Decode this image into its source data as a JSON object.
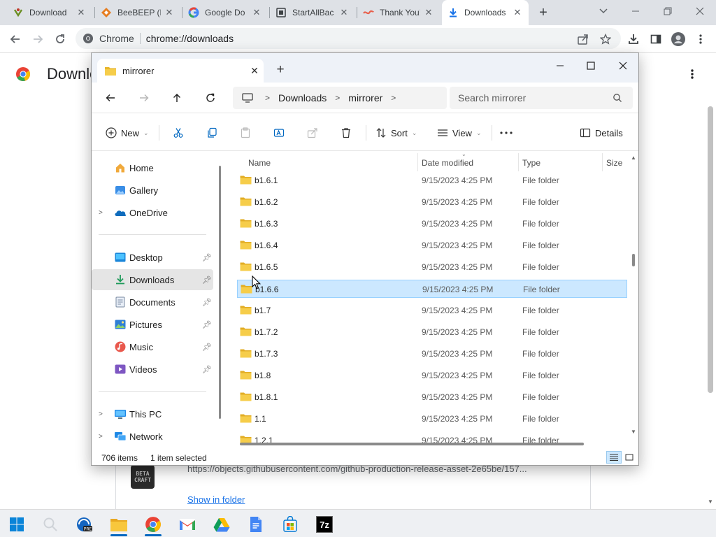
{
  "browser": {
    "tabs": [
      {
        "title": "Download",
        "icon": "download-page-favicon"
      },
      {
        "title": "BeeBEEP (F",
        "icon": "beebeep-favicon"
      },
      {
        "title": "Google Do",
        "icon": "google-favicon"
      },
      {
        "title": "StartAllBac",
        "icon": "startallback-favicon"
      },
      {
        "title": "Thank You!",
        "icon": "thankyou-favicon"
      },
      {
        "title": "Downloads",
        "icon": "download-icon",
        "active": true
      }
    ],
    "omnibox": {
      "site_label": "Chrome",
      "url": "chrome://downloads"
    },
    "page": {
      "title": "Downlo",
      "item": {
        "logo_text": "BETA CRAFT",
        "url": "https://objects.githubusercontent.com/github-production-release-asset-2e65be/157...",
        "show_in_folder": "Show in folder"
      }
    }
  },
  "explorer": {
    "tab_title": "mirrorer",
    "breadcrumb": [
      "Downloads",
      "mirrorer"
    ],
    "search_placeholder": "Search mirrorer",
    "commands": {
      "new": "New",
      "sort": "Sort",
      "view": "View",
      "details": "Details"
    },
    "nav": {
      "home": "Home",
      "gallery": "Gallery",
      "onedrive": "OneDrive",
      "desktop": "Desktop",
      "downloads": "Downloads",
      "documents": "Documents",
      "pictures": "Pictures",
      "music": "Music",
      "videos": "Videos",
      "thispc": "This PC",
      "network": "Network"
    },
    "columns": {
      "name": "Name",
      "date": "Date modified",
      "type": "Type",
      "size": "Size"
    },
    "rows": [
      {
        "name": "b1.6.1",
        "date": "9/15/2023 4:25 PM",
        "type": "File folder"
      },
      {
        "name": "b1.6.2",
        "date": "9/15/2023 4:25 PM",
        "type": "File folder"
      },
      {
        "name": "b1.6.3",
        "date": "9/15/2023 4:25 PM",
        "type": "File folder"
      },
      {
        "name": "b1.6.4",
        "date": "9/15/2023 4:25 PM",
        "type": "File folder"
      },
      {
        "name": "b1.6.5",
        "date": "9/15/2023 4:25 PM",
        "type": "File folder"
      },
      {
        "name": "b1.6.6",
        "date": "9/15/2023 4:25 PM",
        "type": "File folder",
        "selected": true
      },
      {
        "name": "b1.7",
        "date": "9/15/2023 4:25 PM",
        "type": "File folder"
      },
      {
        "name": "b1.7.2",
        "date": "9/15/2023 4:25 PM",
        "type": "File folder"
      },
      {
        "name": "b1.7.3",
        "date": "9/15/2023 4:25 PM",
        "type": "File folder"
      },
      {
        "name": "b1.8",
        "date": "9/15/2023 4:25 PM",
        "type": "File folder"
      },
      {
        "name": "b1.8.1",
        "date": "9/15/2023 4:25 PM",
        "type": "File folder"
      },
      {
        "name": "1.1",
        "date": "9/15/2023 4:25 PM",
        "type": "File folder"
      },
      {
        "name": "1.2.1",
        "date": "9/15/2023 4:25 PM",
        "type": "File folder"
      }
    ],
    "status": {
      "count": "706 items",
      "selection": "1 item selected"
    }
  },
  "taskbar": {
    "items": [
      "windows-start-icon",
      "search-icon",
      "app-icon",
      "file-explorer-icon",
      "chrome-icon",
      "gmail-icon",
      "google-drive-icon",
      "google-docs-icon",
      "store-icon",
      "7zip-icon"
    ],
    "sevenzip_label": "7z"
  },
  "colors": {
    "accent": "#0067c0",
    "selection": "#cce8ff",
    "folder": "#f4c542",
    "link": "#1a73e8"
  }
}
